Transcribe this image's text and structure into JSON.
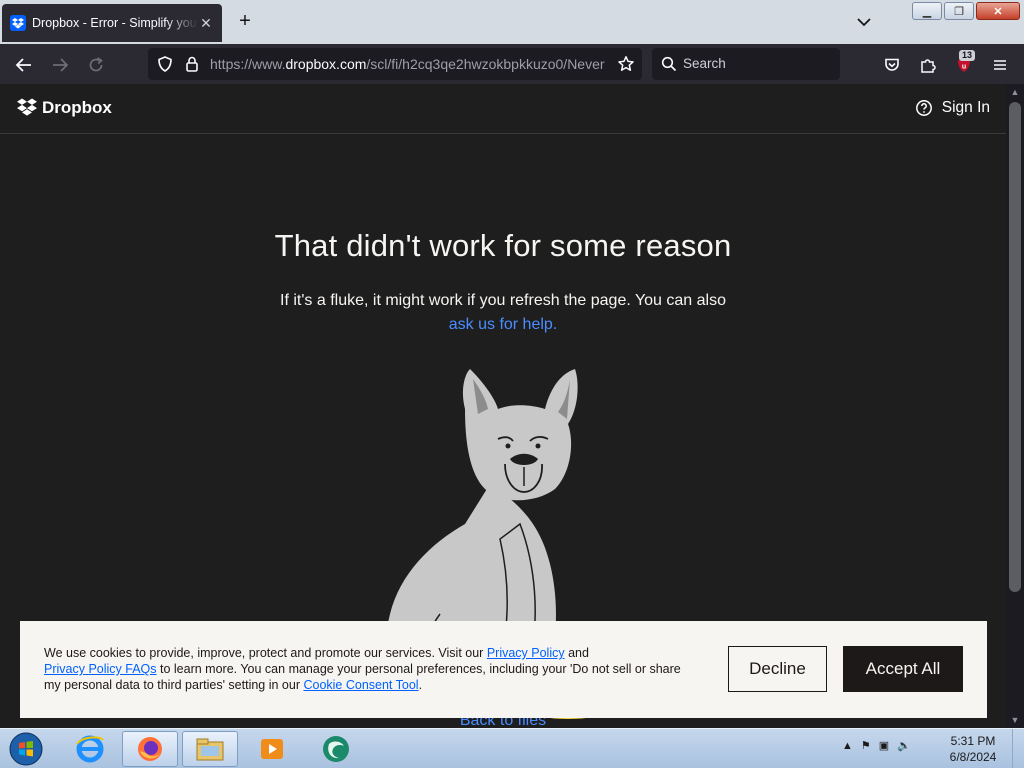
{
  "browser": {
    "tab": {
      "title": "Dropbox - Error - Simplify your life",
      "close_icon": "close-icon"
    },
    "new_tab_icon": "plus-icon",
    "url": {
      "prefix": "https://www.",
      "host": "dropbox.com",
      "path": "/scl/fi/h2cq3qe2hwzokbpkkuzo0/Never"
    },
    "search_placeholder": "Search",
    "extension_badge": "13"
  },
  "site": {
    "logo_text": "Dropbox",
    "signin_label": "Sign In",
    "heading": "That didn't work for some reason",
    "description": "If it's a fluke, it might work if you refresh the page. You can also",
    "help_link": "ask us for help.",
    "back_link": "Back to files"
  },
  "cookie": {
    "text_1": "We use cookies to provide, improve, protect and promote our services. Visit our ",
    "privacy_policy": "Privacy Policy",
    "text_2": " and ",
    "privacy_faqs": "Privacy Policy FAQs",
    "text_3": " to learn more. You can manage your personal preferences, including your 'Do not sell or share my personal data to third parties' setting in our ",
    "consent_tool": "Cookie Consent Tool",
    "text_4": ".",
    "decline_label": "Decline",
    "accept_label": "Accept All"
  },
  "taskbar": {
    "time": "5:31 PM",
    "date": "6/8/2024"
  },
  "colors": {
    "page_bg": "#1e1e1e",
    "link": "#4a8cff",
    "dropbox_blue": "#0061fe",
    "dog_fill": "#c8c8c8",
    "bowl": "#f5d547"
  }
}
